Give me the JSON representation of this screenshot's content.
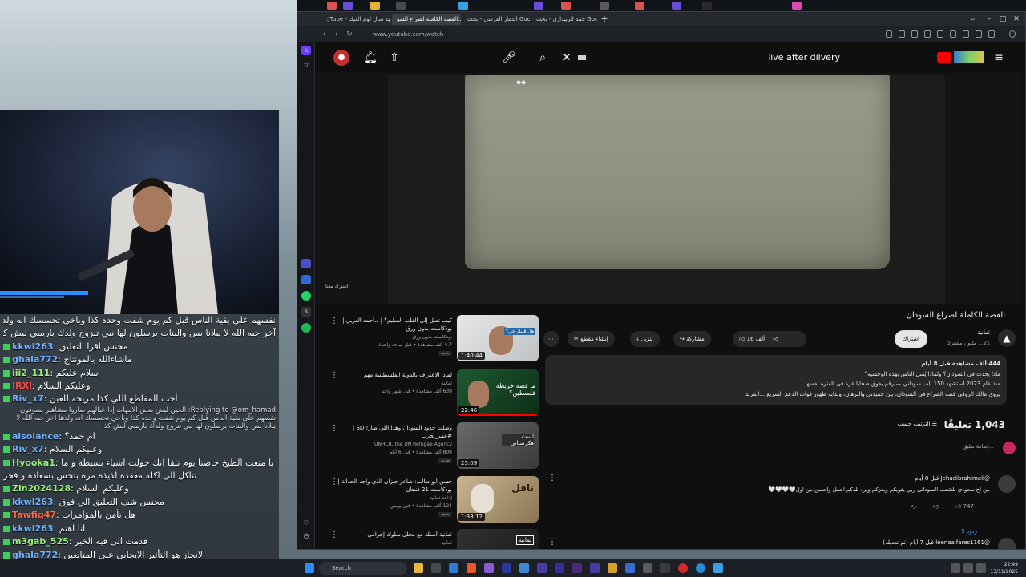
{
  "browser": {
    "tabs": [
      {
        "label": ":/Tube - لهد سال لوم القيك"
      },
      {
        "label": "القصة الكاملة لصراع السو..."
      },
      {
        "label": "الدمار القرشي - بحث Google"
      },
      {
        "label": "حمد الزبيدازي - بحث Google"
      }
    ],
    "new_tab": "+",
    "url": "www.youtube.com/watch"
  },
  "youtube": {
    "search_query": "live after dilvery",
    "player_caption": "اشترك معنا",
    "video_title": "القصة الكاملة لصراع السودان",
    "channel_name": "ثمانية",
    "channel_subscribers": "1.21 مليون مشترك",
    "subscribe_label": "اشتراك",
    "actions": {
      "like_count": "16 ألف",
      "share": "مشاركة",
      "download": "تنزيل",
      "clip": "إنشاء مقطع",
      "more": "⋯"
    },
    "description": {
      "meta": "444 ألف مشاهدة  قبل 8 أيام",
      "line1": "ماذا يحدث في السودان؟ ولماذا يُقتل الناس بهذه الوحشية؟",
      "line2": "منذ عام 2023 استشهد 150 ألف سوداني — رقم يفوق ضحايا غزة في الفترة نفسها.",
      "line3": "يروي مالك الروقي قصة الصراع في السودان، بين حميدتي والبرهان، وبداية ظهور قوات الدعم السريع ...المزيد"
    },
    "comments_count": "1,043 تعليقًا",
    "sort_label": "الترتيب حسب",
    "add_comment_placeholder": "إضافة تعليق...",
    "comments": [
      {
        "author": "@Jehadibrahimali  قبل 8 أيام",
        "text": "من اخ سعودي للشعب السوداني ربي يقويكم ويعزكم ويرد بلدكم اجمل واحسن من اول🤍🤍🤍🤍",
        "likes": "747",
        "reply": "رد",
        "replies": "5 ردود"
      },
      {
        "author": "@leenaalfares1161  قبل 7 أيام (تم تعديله)",
        "text": "",
        "likes": "",
        "reply": "",
        "replies": ""
      }
    ],
    "related": [
      {
        "title": "كيف تصل إلى القلب السليم؟ | د.أحمد العربي | بودكاست بدون ورق",
        "channel": "بودكاست بدون ورق",
        "meta": "4.7 ألف مشاهدة • قبل ساعة واحدة",
        "badge": "جديد",
        "duration": "1:40:44",
        "thumb_text": "هل قلبك حي؟"
      },
      {
        "title": "لماذا الاعتراف بالدولة الفلسطينية مهم",
        "channel": "ثمانية",
        "meta": "639 ألف مشاهدة • قبل شهر واحد",
        "badge": "",
        "duration": "22:46",
        "thumb_text": "ما قصة خريطة فلسطين؟"
      },
      {
        "title": "وصلت حدود السودان وهذا اللي صار! SD | #عمر_يجرب",
        "channel": "UNHCR, the UN Refugee Agency",
        "meta": "809 ألف مشاهدة • قبل 6 أيام",
        "badge": "جديد",
        "duration": "25:09",
        "thumb_text": "لست هكرستاني"
      },
      {
        "title": "حسن أبو طالب: شاعر جيزان الذي واجه الحداثة | بودكاست 21 فنجان",
        "channel": "إذاعة ثمانية",
        "meta": "124 ألف مشاهدة • قبل يومين",
        "badge": "جديد",
        "duration": "1:33:12",
        "thumb_text": "ناقل"
      },
      {
        "title": "ثمانية أسئلة مع محلل سلوك إجرامي",
        "channel": "ثمانية",
        "meta": "",
        "badge": "",
        "duration": "",
        "thumb_text": "ثمانية"
      }
    ]
  },
  "chat": {
    "top_lines": [
      "نفسهم على بقية الناس قبل كم يوم شفت وحده كذا وياخي تحسسك انه ولدها",
      "آخر حبه الله لا يبلانا بس والبنات يرسلون لها نبي تنزوج ولدك ياربيبي ليش كذا"
    ],
    "messages": [
      {
        "user": "kkwl263",
        "text": ": محنس اقرا التعليق",
        "color": "#6fb2ff"
      },
      {
        "user": "ghala772",
        "text": ": ماشاءالله يالمونتاج",
        "color": "#6fb2ff"
      },
      {
        "user": "iii2_111",
        "text": ": سلام عليكم",
        "color": "#9cf07a"
      },
      {
        "user": "IRXI",
        "text": ": وعليكم السلام",
        "color": "#ff4a4a"
      },
      {
        "user": "Riv_x7",
        "text": ": أحب المقاطع اللي كذا مريحة للعين",
        "color": "#6fb2ff"
      }
    ],
    "reply_to": "Replying to @om_hamad: الحين ليش بعض الامهات إذا عيالهم صاروا مشاهير يشوفون نفسهم على بقية الناس قبل كم يوم شفت وحده كذا وياخي تحسسك انه ولدها آخر حبه الله لا يبلانا بس والبنات يرسلون لها نبي تنزوج ولدك ياربيبي ليش كذا",
    "messages2": [
      {
        "user": "alsolance",
        "text": ": ام حمد؟",
        "color": "#6fb2ff"
      },
      {
        "user": "Riv_x7",
        "text": ": وعليكم السلام",
        "color": "#6fb2ff"
      },
      {
        "user": "Hyooka1",
        "text": ": يا متعت الطبخ خاصتا يوم تلقا انك حولت اشياء بسيطة و ما",
        "color": "#9cf07a"
      },
      {
        "user": "",
        "text": "تتاكل الى اكلة معقدة لذيذة مرة بتحس بسعادة و فخر",
        "color": "#ffffff"
      },
      {
        "user": "Zin2024128",
        "text": ": وعليكم السلام",
        "color": "#9cf07a"
      },
      {
        "user": "kkwl263",
        "text": ": محنس شف التعليق الي فوق",
        "color": "#6fb2ff"
      },
      {
        "user": "Tawfiq47",
        "text": ": هل تأمن بالمؤامرات",
        "color": "#ff6a4a"
      },
      {
        "user": "kkwl263",
        "text": ": انا اهتم",
        "color": "#6fb2ff"
      },
      {
        "user": "m3gab_525",
        "text": ": قدمت الى فيه الخير",
        "color": "#9cf07a"
      },
      {
        "user": "ghala772",
        "text": ": الانجاز هو التأثير الايجابي على المتابعين",
        "color": "#6fb2ff"
      }
    ]
  },
  "taskbar": {
    "search_label": "Search",
    "time": "22:49",
    "date": "13/11/2025"
  }
}
